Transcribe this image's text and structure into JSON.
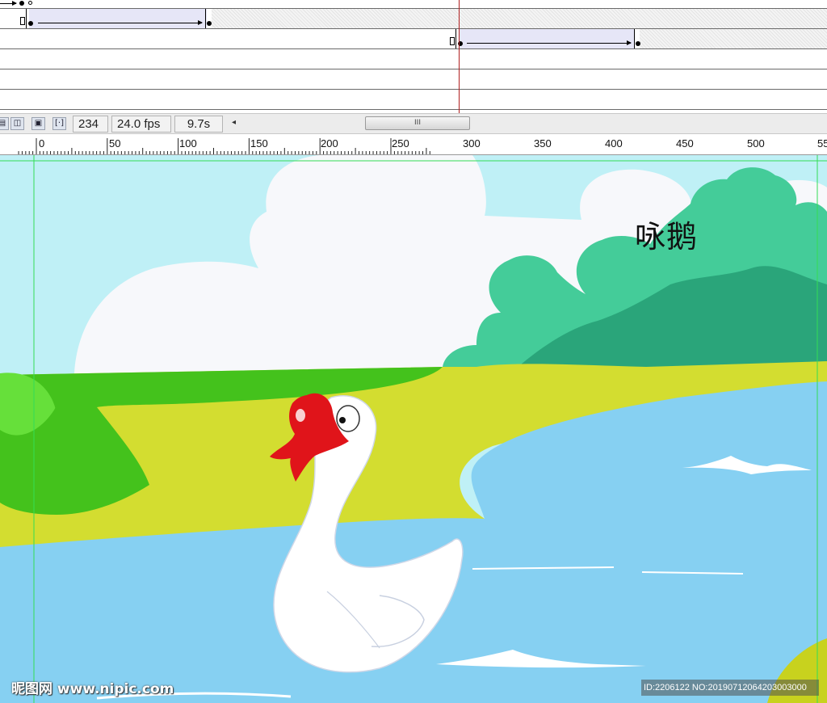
{
  "statusbar": {
    "frame": "234",
    "fps": "24.0 fps",
    "time": "9.7s",
    "scroll_left_glyph": "◂",
    "scroll_thumb_glyph": "III"
  },
  "toolbar_icons": [
    "onion-skin-icon",
    "onion-skin-outlines-icon",
    "edit-multiple-frames-icon",
    "modify-markers-icon"
  ],
  "ruler": {
    "labels": [
      "0",
      "50",
      "100",
      "150",
      "200",
      "250",
      "300",
      "350",
      "400",
      "450",
      "500",
      "55"
    ]
  },
  "stage": {
    "title": "咏鹅"
  },
  "watermark": {
    "left": "昵图网 www.nipic.com",
    "right": "ID:2206122 NO:20190712064203003000"
  },
  "colors": {
    "sky": "#bff0f6",
    "cloud": "#f7f8fb",
    "tree_light": "#44cc99",
    "tree_dark": "#2aa57a",
    "grass_green": "#44c21c",
    "field_yellow": "#d3dd30",
    "water": "#86d0f2",
    "beak": "#e0141a",
    "swan": "#ffffff",
    "guide": "#33dd55",
    "playhead": "#b02020"
  }
}
